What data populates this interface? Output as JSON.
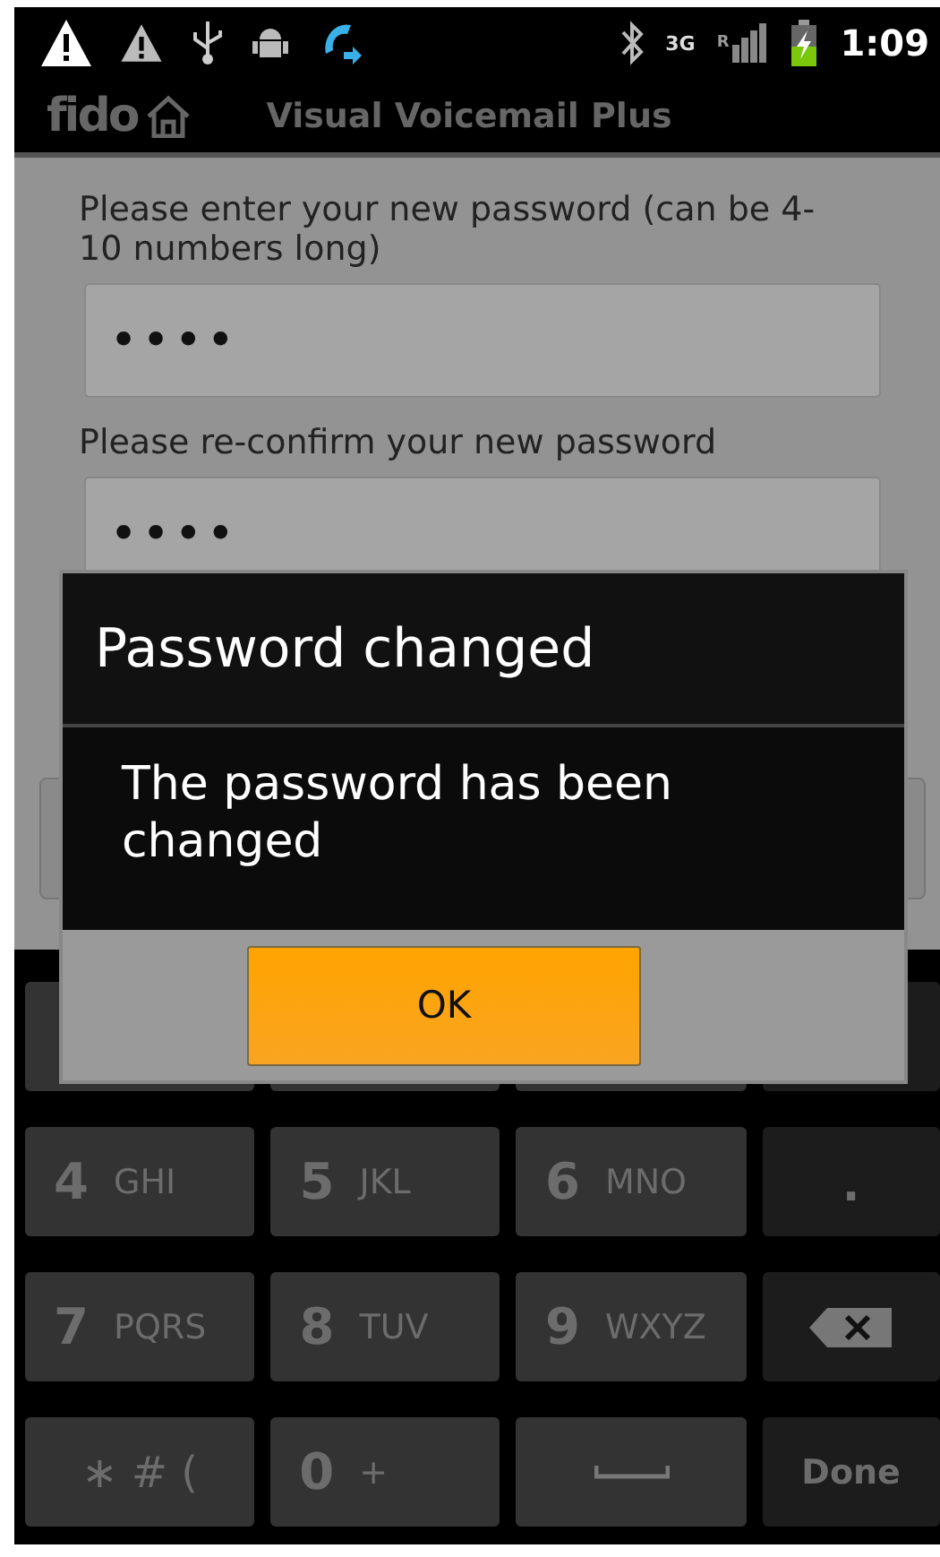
{
  "status_bar": {
    "network_type": "3G",
    "roaming": "R",
    "time": "1:09"
  },
  "app_bar": {
    "logo": "fido",
    "title": "Visual Voicemail Plus"
  },
  "form": {
    "fields": [
      {
        "label": "Please enter your new password (can be 4-10 numbers long)",
        "value": "••••"
      },
      {
        "label": "Please re-confirm your new password",
        "value": "••••"
      }
    ]
  },
  "dialog": {
    "title": "Password changed",
    "message": "The password has been changed",
    "buttons": [
      "OK"
    ]
  },
  "keypad": {
    "rows": [
      [
        {
          "kind": "hidden"
        },
        {
          "kind": "hidden"
        },
        {
          "kind": "hidden"
        },
        {
          "kind": "hidden"
        }
      ],
      [
        {
          "kind": "digit",
          "digit": "4",
          "letters": "GHI"
        },
        {
          "kind": "digit",
          "digit": "5",
          "letters": "JKL"
        },
        {
          "kind": "digit",
          "digit": "6",
          "letters": "MNO"
        },
        {
          "kind": "symbol",
          "label": "."
        }
      ],
      [
        {
          "kind": "digit",
          "digit": "7",
          "letters": "PQRS"
        },
        {
          "kind": "digit",
          "digit": "8",
          "letters": "TUV"
        },
        {
          "kind": "digit",
          "digit": "9",
          "letters": "WXYZ"
        },
        {
          "kind": "backspace"
        }
      ],
      [
        {
          "kind": "text",
          "label": "∗ # ("
        },
        {
          "kind": "digit",
          "digit": "0",
          "letters": "+"
        },
        {
          "kind": "space"
        },
        {
          "kind": "action",
          "label": "Done"
        }
      ]
    ]
  }
}
